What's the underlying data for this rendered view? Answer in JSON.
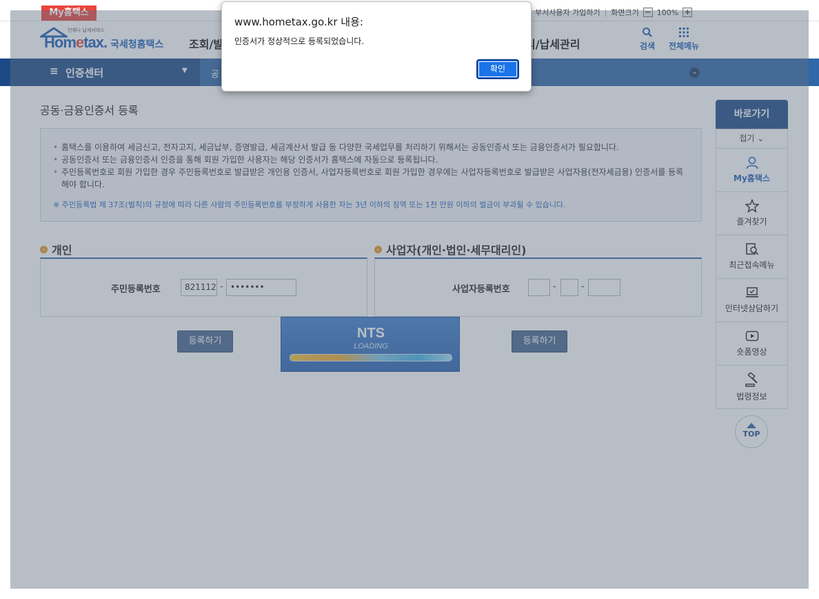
{
  "topbar": {
    "my_tab": "My홈택스",
    "util_link": "부서사용자 가입하기",
    "screen_size_label": "화면크기",
    "zoom_minus": "−",
    "zoom_value": "100%",
    "zoom_plus": "+"
  },
  "header": {
    "logo_sub": "언제나 납세서비스",
    "logo_brand_1": "Hom",
    "logo_brand_e": "e",
    "logo_brand_2": "tax.",
    "logo_kr": "국세청홈택스",
    "gnb_left": "조회/발",
    "gnb_right": "리/납세관리",
    "search_label": "검색",
    "allmenu_label": "전체메뉴"
  },
  "location": {
    "menu_icon": "≡",
    "menu_title": "인증센터",
    "caret": "▼",
    "sub": "공",
    "chevron": "⌄"
  },
  "page": {
    "title": "공동·금융인증서 등록",
    "info": [
      "홈택스를 이용하여 세금신고, 전자고지, 세금납부, 증명발급, 세금계산서 발급 등 다양한 국세업무를 처리하기 위해서는 공동인증서 또는 금융인증서가 필요합니다.",
      "공동인증서 또는 금융인증서 인증을 통해 회원 가입한 사용자는 해당 인증서가 홈택스에 자동으로 등록됩니다.",
      "주민등록번호로 회원 가입한 경우 주민등록번호로 발급받은 개인용 인증서, 사업자등록번호로 회원 가입한 경우에는 사업자등록번호로 발급받은 사업자용(전자세금용) 인증서를 등록해야 합니다."
    ],
    "notice": "※ 주민등록법 제 37조(벌칙)의 규정에 따라 다른 사람의 주민등록번호를 부정하게 사용한 자는 3년 이하의 징역 또는 1천 만원 이하의 벌금이 부과될 수 있습니다."
  },
  "personal": {
    "section_title": "개인",
    "field_label": "주민등록번호",
    "rrn_front": "821112",
    "rrn_back": "•••••••",
    "dash": "-",
    "register_button": "등록하기"
  },
  "business": {
    "section_title": "사업자(개인·법인·세무대리인)",
    "field_label": "사업자등록번호",
    "dash": "-",
    "register_button": "등록하기"
  },
  "loading": {
    "brand": "NTS",
    "text": "LOADING"
  },
  "quick": {
    "header": "바로가기",
    "fold": "접기 ⌄",
    "items": [
      "My홈택스",
      "즐겨찾기",
      "최근접속메뉴",
      "인터넷상담하기",
      "숏폼영상",
      "법령정보"
    ],
    "top": "TOP"
  },
  "dialog": {
    "title": "www.hometax.go.kr 내용:",
    "message": "인증서가 정상적으로 등록되었습니다.",
    "ok_button": "확인"
  },
  "colors": {
    "primary": "#1c4a85",
    "accent_red": "#e8463e",
    "dialog_button": "#1a73e8"
  }
}
